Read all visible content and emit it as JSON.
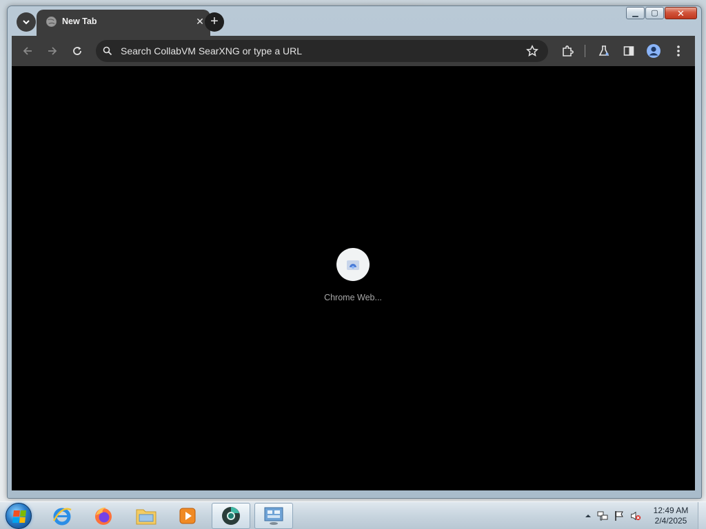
{
  "browser": {
    "tab": {
      "title": "New Tab"
    },
    "omnibox": {
      "placeholder": "Search CollabVM SearXNG or type a URL"
    },
    "shortcut": {
      "label": "Chrome Web..."
    }
  },
  "taskbar": {
    "apps": [
      {
        "name": "Internet Explorer",
        "icon": "internet-explorer-icon"
      },
      {
        "name": "Firefox",
        "icon": "firefox-icon"
      },
      {
        "name": "Windows Explorer",
        "icon": "file-explorer-icon"
      },
      {
        "name": "Windows Media Player",
        "icon": "media-player-icon"
      },
      {
        "name": "Chrome (active)",
        "icon": "chrome-canary-icon"
      },
      {
        "name": "Control Panel",
        "icon": "control-panel-icon"
      }
    ],
    "clock": {
      "time": "12:49 AM",
      "date": "2/4/2025"
    }
  },
  "colors": {
    "tab_bg": "#3c3c3c",
    "omnibox_bg": "#282828",
    "content_bg": "#000000",
    "profile_accent": "#8ab4f8"
  }
}
